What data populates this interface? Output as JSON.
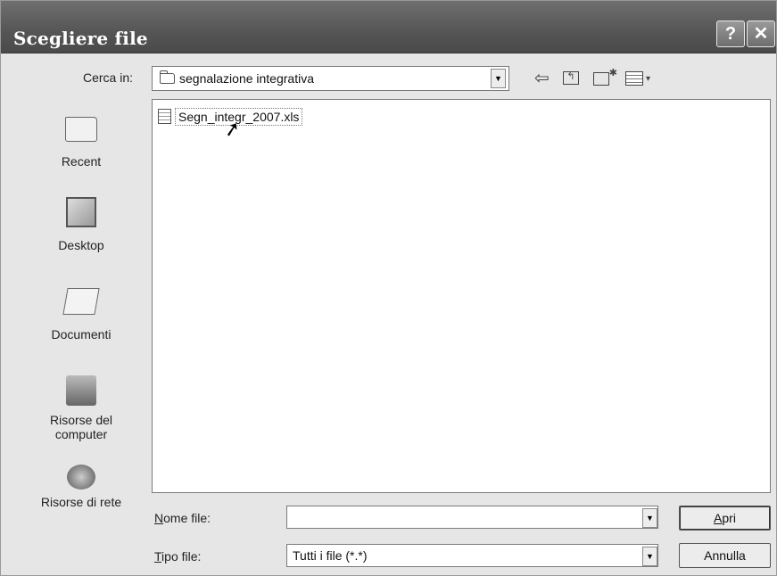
{
  "window": {
    "title": "Scegliere file",
    "help_glyph": "?",
    "close_glyph": "✕"
  },
  "toolbar": {
    "look_in_label": "Cerca in:",
    "look_in_value": "segnalazione integrativa",
    "icons": [
      "back-arrow-icon",
      "up-folder-icon",
      "new-folder-icon",
      "views-menu-icon"
    ]
  },
  "places": [
    {
      "label": "Recent",
      "icon": "recent-folder-icon"
    },
    {
      "label": "Desktop",
      "icon": "desktop-icon"
    },
    {
      "label": "Documenti",
      "icon": "documents-icon"
    },
    {
      "label": "Risorse del computer",
      "icon": "computer-icon"
    },
    {
      "label": "Risorse di rete",
      "icon": "network-icon"
    }
  ],
  "files": [
    {
      "name": "Segn_integr_2007.xls",
      "icon": "excel-file-icon"
    }
  ],
  "filename": {
    "label_first": "N",
    "label_rest": "ome file:",
    "value": ""
  },
  "filetype": {
    "label_first": "T",
    "label_rest": "ipo file:",
    "value": "Tutti i file (*.*)"
  },
  "buttons": {
    "open_first": "A",
    "open_rest": "pri",
    "cancel": "Annulla"
  }
}
